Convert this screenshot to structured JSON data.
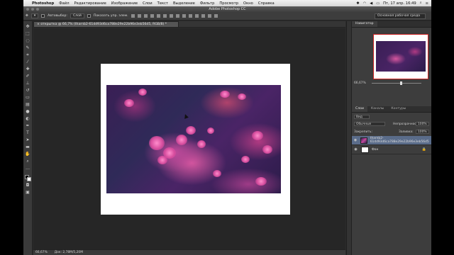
{
  "menubar": {
    "app": "Photoshop",
    "items": [
      "Файл",
      "Редактирование",
      "Изображение",
      "Слои",
      "Текст",
      "Выделение",
      "Фильтр",
      "Просмотр",
      "Окно",
      "Справка"
    ],
    "datetime": "Пт, 17 апр. 16:49"
  },
  "window": {
    "title": "Adobe Photoshop CC"
  },
  "options": {
    "autoselect_label": "Автовыбор:",
    "autoselect_value": "Слой",
    "show_controls": "Показать упр. элем.",
    "workspace": "Основная рабочая среда"
  },
  "document": {
    "tab_label": "открытка @ 66,7% (tharnb2-61dd93d6ca788e29e22b96e3eb56d5, RGB/8) *",
    "zoom": "66,67%",
    "doc_info": "Док: 2,78M/5,20M"
  },
  "navigator": {
    "tab": "Навигатор",
    "zoom": "66,67%"
  },
  "layers_panel": {
    "tabs": [
      "Слои",
      "Каналы",
      "Контуры"
    ],
    "kind_label": "Вид",
    "blend_mode": "Обычные",
    "opacity_label": "Непрозрачность:",
    "opacity_value": "100%",
    "lock_label": "Закрепить:",
    "fill_label": "Заливка:",
    "fill_value": "100%",
    "layers": [
      {
        "name": "tharnb2-61dd93d6ca788e29e22b96e3eb56d5",
        "active": true
      },
      {
        "name": "Фон",
        "active": false
      }
    ]
  },
  "colors": {
    "accent_selection": "#5a6c8a",
    "foreground": "#000000",
    "background": "#ffffff"
  }
}
